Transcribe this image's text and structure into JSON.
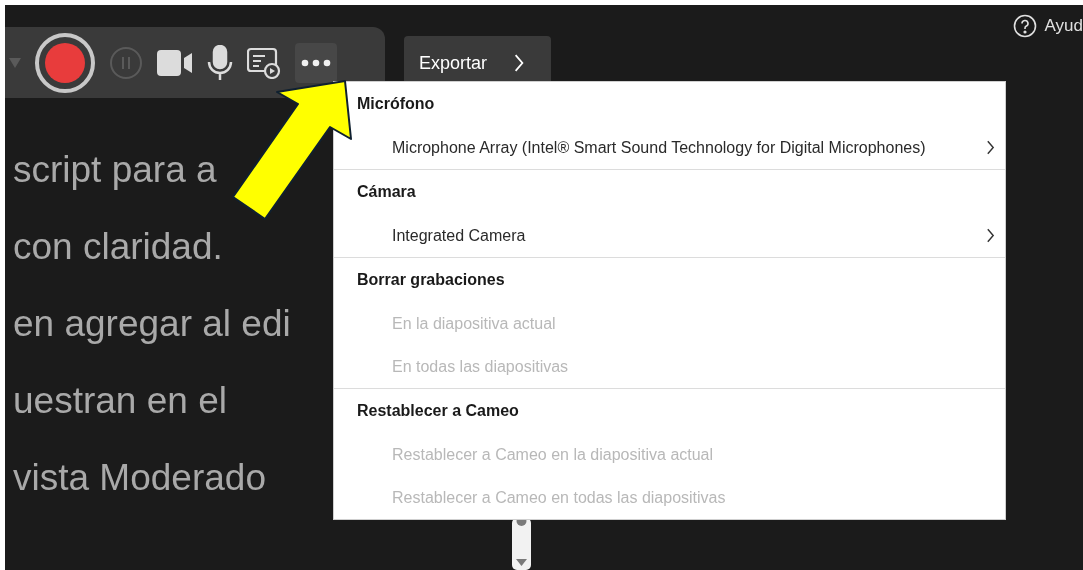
{
  "toolbar": {
    "more_selected": true
  },
  "export_button": {
    "label": "Exportar"
  },
  "help": {
    "label": "Ayud"
  },
  "script_lines": [
    "script para a",
    "con claridad.",
    "en agregar al edi",
    "uestran en el",
    "vista Moderado"
  ],
  "menu": {
    "sections": [
      {
        "title": "Micrófono",
        "items": [
          {
            "label": "Microphone Array (Intel® Smart Sound Technology for Digital Microphones)",
            "disabled": false,
            "submenu": true
          }
        ]
      },
      {
        "title": "Cámara",
        "items": [
          {
            "label": "Integrated Camera",
            "disabled": false,
            "submenu": true
          }
        ]
      },
      {
        "title": "Borrar grabaciones",
        "items": [
          {
            "label": "En la diapositiva actual",
            "disabled": true,
            "submenu": false
          },
          {
            "label": "En todas las diapositivas",
            "disabled": true,
            "submenu": false
          }
        ]
      },
      {
        "title": "Restablecer a Cameo",
        "items": [
          {
            "label": "Restablecer a Cameo en la diapositiva actual",
            "disabled": true,
            "submenu": false
          },
          {
            "label": "Restablecer a Cameo en todas las diapositivas",
            "disabled": true,
            "submenu": false
          }
        ]
      }
    ]
  }
}
